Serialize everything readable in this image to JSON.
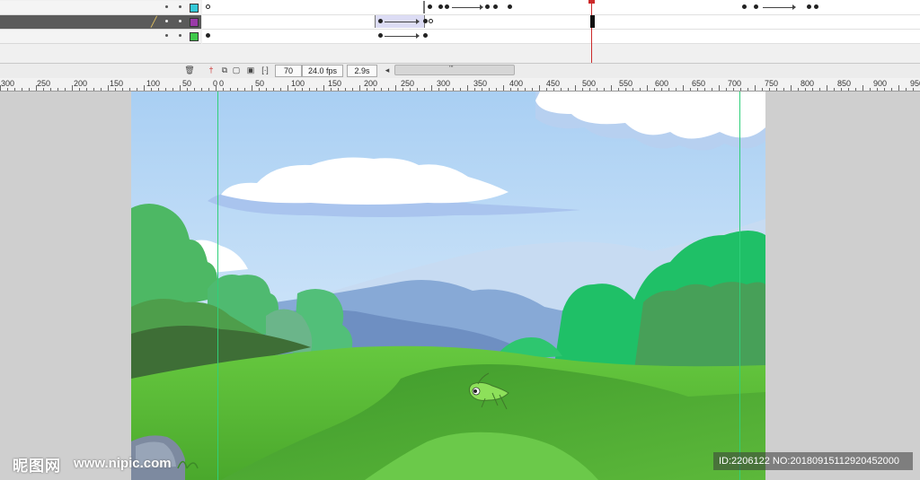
{
  "timeline": {
    "layers": [
      {
        "color": "#33c8d8",
        "selected": false
      },
      {
        "color": "#9a3aa8",
        "selected": true
      },
      {
        "color": "#3ec84a",
        "selected": false
      }
    ],
    "frame_number": "70",
    "fps": "24.0 fps",
    "elapsed": "2.9s",
    "scroll_grip": "'''"
  },
  "ruler": {
    "labels": [
      "300",
      "250",
      "200",
      "150",
      "100",
      "50",
      "0",
      "0",
      "50",
      "100",
      "150",
      "200",
      "250",
      "300",
      "350",
      "400",
      "450",
      "500",
      "550",
      "600",
      "650",
      "700",
      "750",
      "800",
      "850",
      "900",
      "950"
    ]
  },
  "watermark": {
    "logo": "昵图网",
    "site": "www.nipic.com",
    "id": "ID:2206122 NO:20180915112920452000"
  },
  "colors": {
    "sky_top": "#a9cff3",
    "sky_bottom": "#dcedfb",
    "grass": "#5fc33a",
    "guide": "#2fd07a"
  }
}
